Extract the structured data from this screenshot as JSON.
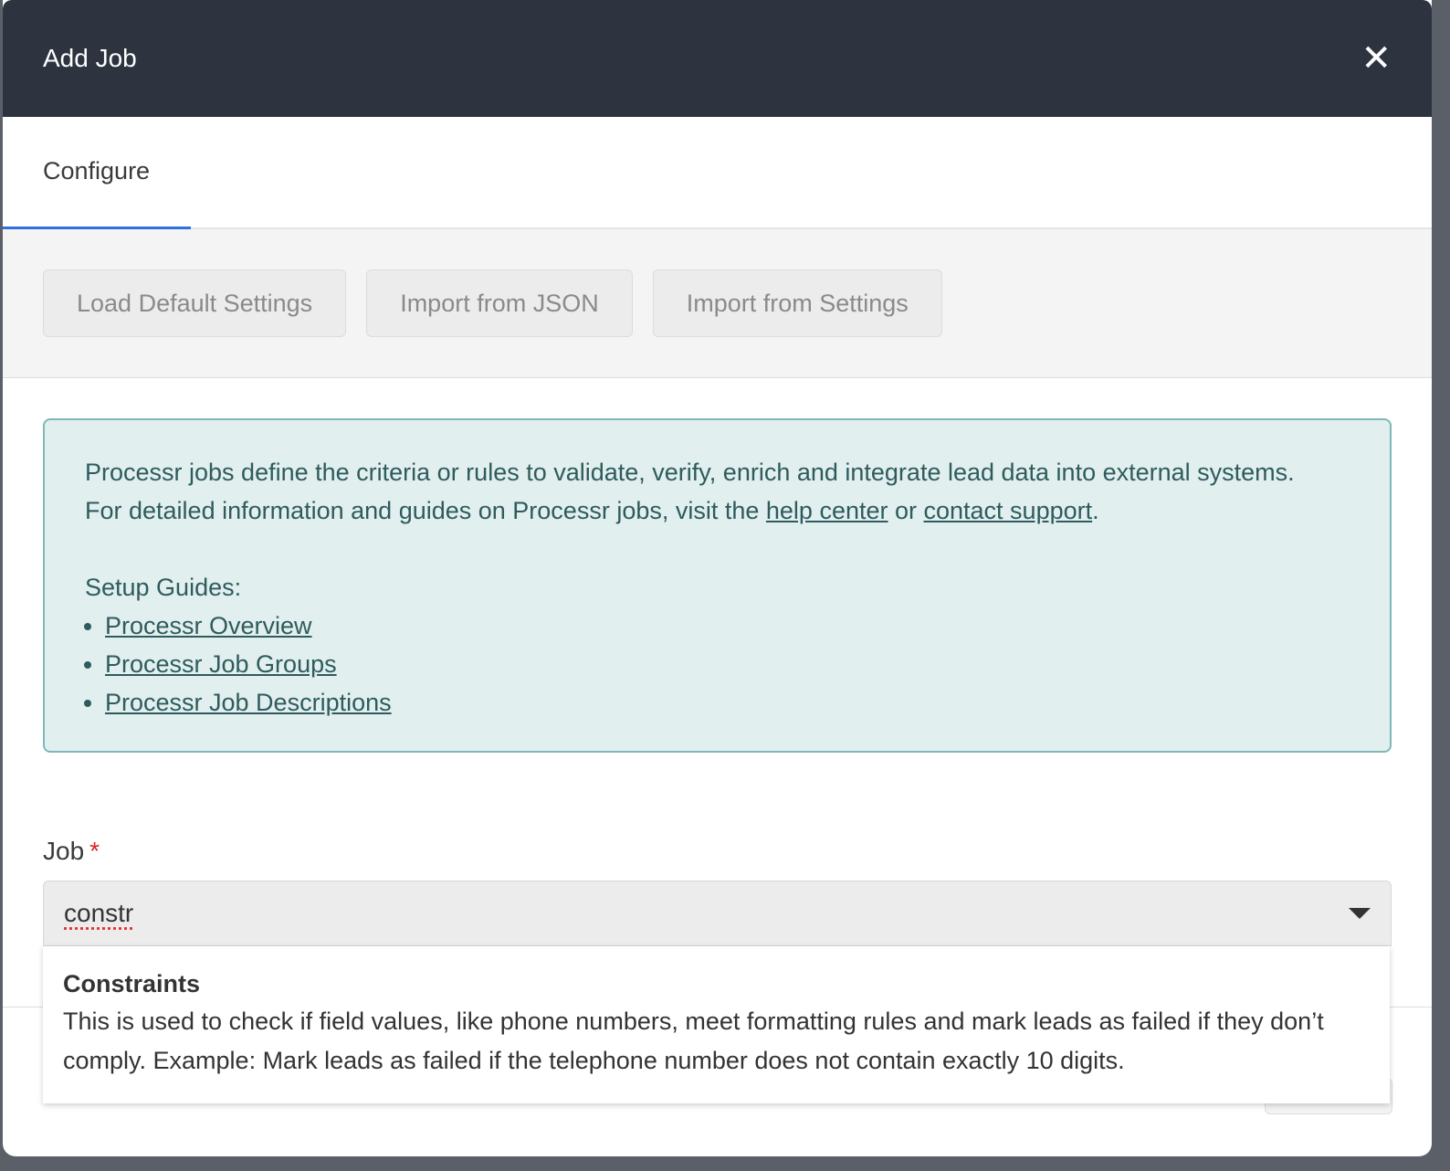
{
  "modal": {
    "title": "Add Job",
    "close_icon": "close-icon"
  },
  "tabs": [
    {
      "label": "Configure",
      "active": true
    }
  ],
  "toolbar": {
    "load_default": "Load Default Settings",
    "import_json": "Import from JSON",
    "import_settings": "Import from Settings"
  },
  "info": {
    "line1": "Processr jobs define the criteria or rules to validate, verify, enrich and integrate lead data into external systems.",
    "line2_prefix": "For detailed information and guides on Processr jobs, visit the ",
    "help_center": "help center",
    "line2_mid": " or ",
    "contact_support": "contact support",
    "line2_suffix": ".",
    "guides_heading": "Setup Guides:",
    "guides": [
      "Processr Overview",
      "Processr Job Groups",
      "Processr Job Descriptions"
    ]
  },
  "job_field": {
    "label": "Job",
    "required_mark": "*",
    "value": "constr",
    "caret_icon": "chevron-down-icon"
  },
  "dropdown": {
    "option_title": "Constraints",
    "option_desc": "This is used to check if field values, like phone numbers, meet formatting rules and mark leads as failed if they don’t comply. Example: Mark leads as failed if the telephone number does not contain exactly 10 digits."
  },
  "colors": {
    "header_bg": "#2d3440",
    "accent": "#2f6fe0",
    "info_bg": "#e1efef",
    "info_border": "#7fb8b8",
    "required": "#dd2222"
  }
}
